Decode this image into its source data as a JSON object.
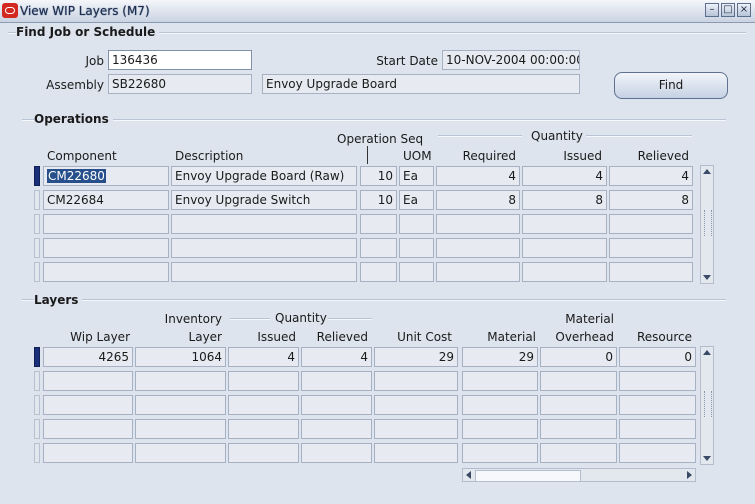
{
  "window": {
    "title": "View WIP Layers (M7)"
  },
  "find": {
    "section_label": "Find Job or Schedule",
    "job_label": "Job",
    "job_value": "136436",
    "start_date_label": "Start Date",
    "start_date_value": "10-NOV-2004 00:00:00",
    "assembly_label": "Assembly",
    "assembly_value": "SB22680",
    "assembly_desc": "Envoy Upgrade Board",
    "find_button": "Find"
  },
  "operations": {
    "section_label": "Operations",
    "headers": {
      "component": "Component",
      "description": "Description",
      "op_seq": "Operation Seq",
      "uom": "UOM",
      "quantity_group": "Quantity",
      "required": "Required",
      "issued": "Issued",
      "relieved": "Relieved"
    },
    "rows": [
      {
        "component": "CM22680",
        "description": "Envoy Upgrade Board (Raw)",
        "op_seq": "10",
        "uom": "Ea",
        "required": "4",
        "issued": "4",
        "relieved": "4"
      },
      {
        "component": "CM22684",
        "description": "Envoy Upgrade Switch",
        "op_seq": "10",
        "uom": "Ea",
        "required": "8",
        "issued": "8",
        "relieved": "8"
      },
      {
        "component": "",
        "description": "",
        "op_seq": "",
        "uom": "",
        "required": "",
        "issued": "",
        "relieved": ""
      },
      {
        "component": "",
        "description": "",
        "op_seq": "",
        "uom": "",
        "required": "",
        "issued": "",
        "relieved": ""
      },
      {
        "component": "",
        "description": "",
        "op_seq": "",
        "uom": "",
        "required": "",
        "issued": "",
        "relieved": ""
      }
    ]
  },
  "layers": {
    "section_label": "Layers",
    "headers": {
      "wip_layer": "Wip Layer",
      "inventory": "Inventory",
      "layer": "Layer",
      "quantity_group": "Quantity",
      "issued": "Issued",
      "relieved": "Relieved",
      "unit_cost": "Unit Cost",
      "material": "Material",
      "material_top": "Material",
      "overhead": "Overhead",
      "resource": "Resource"
    },
    "rows": [
      {
        "wip_layer": "4265",
        "inv_layer": "1064",
        "issued": "4",
        "relieved": "4",
        "unit_cost": "29",
        "material": "29",
        "mat_overhead": "0",
        "resource": "0"
      },
      {
        "wip_layer": "",
        "inv_layer": "",
        "issued": "",
        "relieved": "",
        "unit_cost": "",
        "material": "",
        "mat_overhead": "",
        "resource": ""
      },
      {
        "wip_layer": "",
        "inv_layer": "",
        "issued": "",
        "relieved": "",
        "unit_cost": "",
        "material": "",
        "mat_overhead": "",
        "resource": ""
      },
      {
        "wip_layer": "",
        "inv_layer": "",
        "issued": "",
        "relieved": "",
        "unit_cost": "",
        "material": "",
        "mat_overhead": "",
        "resource": ""
      },
      {
        "wip_layer": "",
        "inv_layer": "",
        "issued": "",
        "relieved": "",
        "unit_cost": "",
        "material": "",
        "mat_overhead": "",
        "resource": ""
      }
    ]
  }
}
